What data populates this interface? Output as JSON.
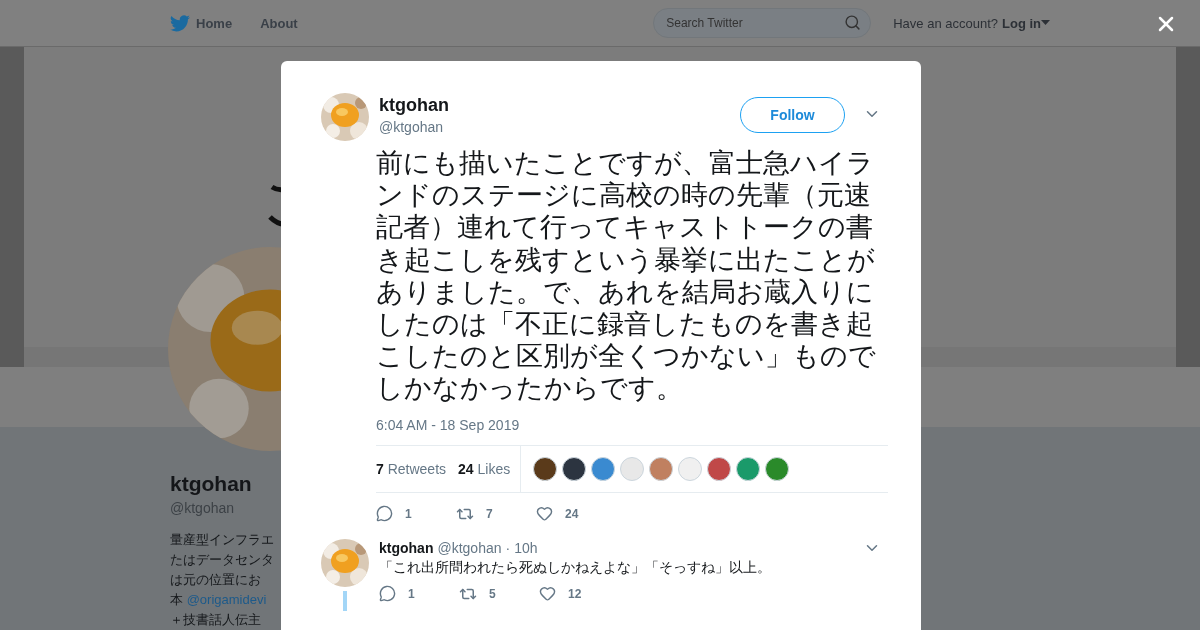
{
  "nav": {
    "links": [
      {
        "label": "Home",
        "kind": "home"
      },
      {
        "label": "About",
        "kind": "plain"
      }
    ],
    "search": {
      "placeholder": "Search Twitter"
    },
    "account_prompt": "Have an account?",
    "login": "Log in"
  },
  "profile": {
    "name": "ktgohan",
    "handle": "@ktgohan",
    "bio_lines": [
      {
        "text": "量産型インフラエ"
      },
      {
        "text": "たはデータセンタ"
      },
      {
        "text": "は元の位置にお"
      },
      {
        "text": "本",
        "link": "@origamidevi"
      },
      {
        "text": "＋技書話人伝主"
      }
    ]
  },
  "tweet": {
    "name": "ktgohan",
    "handle": "@ktgohan",
    "follow": "Follow",
    "text": "前にも描いたことですが、富士急ハイランドのステージに高校の時の先輩（元速記者）連れて行ってキャストトークの書き起こしを残すという暴挙に出たことがありました。で、あれを結局お蔵入りにしたのは「不正に録音したものを書き起こしたのと区別が全くつかない」ものでしかなかったからです。",
    "time": "6:04 AM - 18 Sep 2019",
    "stats": [
      {
        "count": "7",
        "label": "Retweets"
      },
      {
        "count": "24",
        "label": "Likes"
      }
    ],
    "likers": [
      {
        "color": "#5a3a1a"
      },
      {
        "color": "#2c3440"
      },
      {
        "color": "#3a8ad0"
      },
      {
        "color": "#e8e8e8"
      },
      {
        "color": "#c08060"
      },
      {
        "color": "#f0f0f0"
      },
      {
        "color": "#c04848"
      },
      {
        "color": "#1a9a6a"
      },
      {
        "color": "#2a8a2a"
      }
    ],
    "actions": [
      {
        "kind": "reply",
        "count": "1"
      },
      {
        "kind": "retweet",
        "count": "7"
      },
      {
        "kind": "like",
        "count": "24"
      }
    ]
  },
  "replies": [
    {
      "name": "ktgohan",
      "handle": "@ktgohan",
      "separator": "·",
      "time": "10h",
      "text": "「これ出所問われたら死ぬしかねえよな」「そっすね」以上。",
      "actions": [
        {
          "kind": "reply",
          "count": "1"
        },
        {
          "kind": "retweet",
          "count": "5"
        },
        {
          "kind": "like",
          "count": "12"
        }
      ]
    }
  ]
}
